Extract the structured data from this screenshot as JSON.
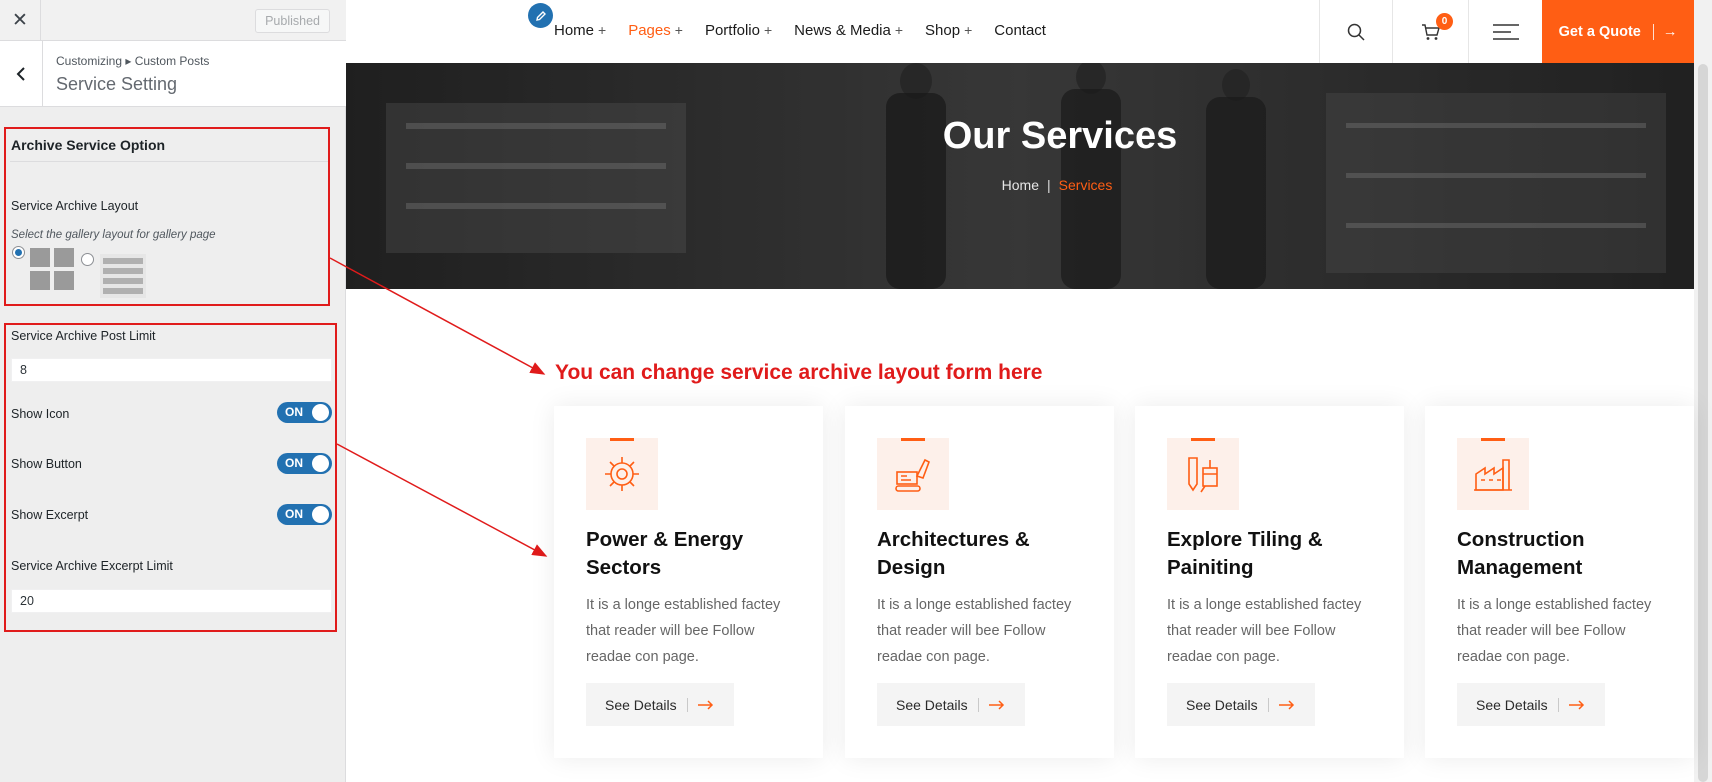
{
  "customizer": {
    "close_label": "✕",
    "published_label": "Published",
    "breadcrumb": "Customizing ▸ Custom Posts",
    "title": "Service Setting",
    "archive_section_title": "Archive Service Option",
    "layout_label": "Service Archive Layout",
    "layout_description": "Select the gallery layout for gallery page",
    "layout_selected": "grid",
    "post_limit_label": "Service Archive Post Limit",
    "post_limit_value": "8",
    "show_icon_label": "Show Icon",
    "show_button_label": "Show Button",
    "show_excerpt_label": "Show Excerpt",
    "toggle_on_label": "ON",
    "excerpt_limit_label": "Service Archive Excerpt Limit",
    "excerpt_limit_value": "20"
  },
  "header": {
    "nav": [
      {
        "label": "Home",
        "has_plus": true
      },
      {
        "label": "Pages",
        "has_plus": true,
        "active": true
      },
      {
        "label": "Portfolio",
        "has_plus": true
      },
      {
        "label": "News & Media",
        "has_plus": true
      },
      {
        "label": "Shop",
        "has_plus": true
      },
      {
        "label": "Contact",
        "has_plus": false
      }
    ],
    "plus_symbol": "+",
    "cart_count": "0",
    "quote_label": "Get a Quote",
    "quote_arrow": "→"
  },
  "hero": {
    "title": "Our Services",
    "breadcrumb_home": "Home",
    "breadcrumb_sep": "|",
    "breadcrumb_current": "Services"
  },
  "annotation": "You can change service archive layout form here",
  "services": [
    {
      "title": "Power & Energy Sectors",
      "text": "It is a longe established factey that reader will bee Follow readae con page.",
      "button": "See Details",
      "icon": "gear-icon"
    },
    {
      "title": "Architectures & Design",
      "text": "It is a longe established factey that reader will bee Follow readae con page.",
      "button": "See Details",
      "icon": "crane-icon"
    },
    {
      "title": "Explore Tiling & Painiting",
      "text": "It is a longe established factey that reader will bee Follow readae con page.",
      "button": "See Details",
      "icon": "tools-icon"
    },
    {
      "title": "Construction Management",
      "text": "It is a longe established factey that reader will bee Follow readae con page.",
      "button": "See Details",
      "icon": "factory-icon"
    }
  ],
  "colors": {
    "accent": "#ff5e14",
    "toggle": "#2271b1",
    "annotation": "#e01b1b"
  }
}
